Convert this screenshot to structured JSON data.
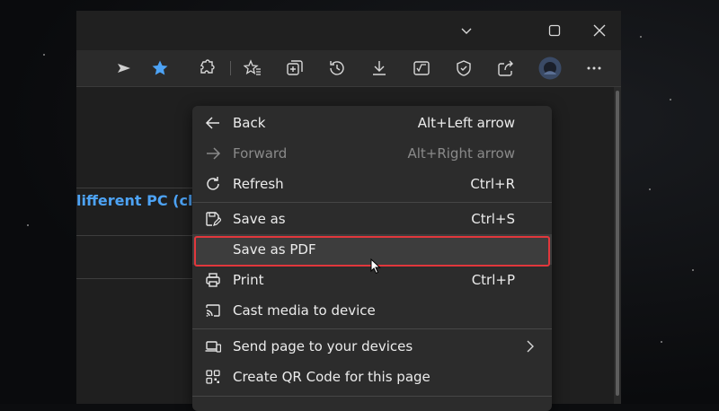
{
  "page": {
    "link_text": "lifferent PC (click"
  },
  "menu": {
    "items": [
      {
        "label": "Back",
        "shortcut": "Alt+Left arrow"
      },
      {
        "label": "Forward",
        "shortcut": "Alt+Right arrow"
      },
      {
        "label": "Refresh",
        "shortcut": "Ctrl+R"
      },
      {
        "label": "Save as",
        "shortcut": "Ctrl+S"
      },
      {
        "label": "Save as PDF",
        "shortcut": ""
      },
      {
        "label": "Print",
        "shortcut": "Ctrl+P"
      },
      {
        "label": "Cast media to device",
        "shortcut": ""
      },
      {
        "label": "Send page to your devices",
        "shortcut": ""
      },
      {
        "label": "Create QR Code for this page",
        "shortcut": ""
      }
    ]
  },
  "colors": {
    "highlight_border": "#e1373c",
    "favorite_star": "#4da3f5",
    "link": "#4da3f5"
  },
  "icons": {
    "toolbar": [
      "send-arrow-icon",
      "favorite-star-icon",
      "extensions-icon",
      "favorites-icon",
      "collections-icon",
      "history-icon",
      "downloads-icon",
      "math-solver-icon",
      "browser-essentials-icon",
      "share-icon",
      "profile-avatar",
      "more-options-icon"
    ]
  }
}
